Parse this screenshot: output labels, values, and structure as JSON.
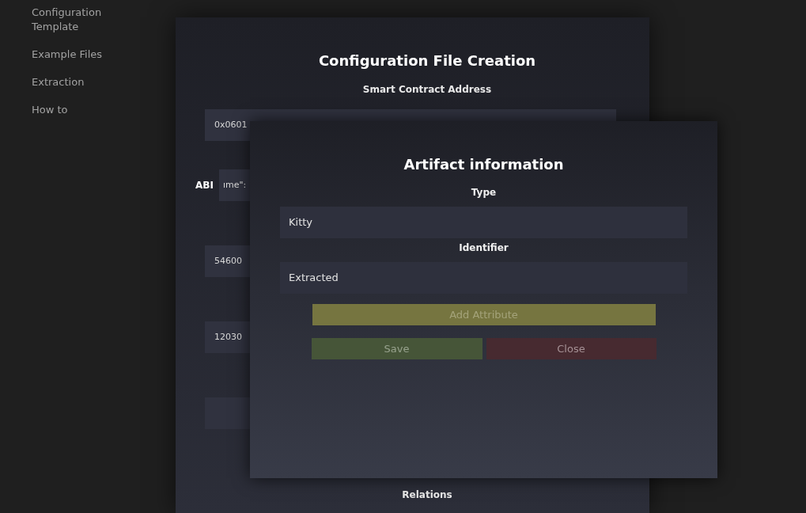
{
  "sidebar": {
    "items": [
      {
        "label": "Configuration Template"
      },
      {
        "label": "Example Files"
      },
      {
        "label": "Extraction"
      },
      {
        "label": "How to"
      }
    ]
  },
  "form": {
    "title": "Configuration File Creation",
    "section_label": "Smart Contract Address",
    "fields": [
      {
        "kind": "text",
        "value": "0x0601"
      },
      {
        "kind": "text",
        "label": "ABI",
        "value": "ıme\":"
      },
      {
        "kind": "text",
        "value": "54600"
      },
      {
        "kind": "text",
        "value": "12030"
      },
      {
        "kind": "blank"
      }
    ],
    "footer_label": "Relations"
  },
  "dialog": {
    "title": "Artifact information",
    "fields": [
      {
        "label": "Type",
        "value": "Kitty"
      },
      {
        "label": "Identifier",
        "value": "Extracted"
      }
    ],
    "buttons": [
      {
        "kind": "add",
        "label": "Add Attribute"
      },
      {
        "kind": "save",
        "label": "Save"
      },
      {
        "kind": "close",
        "label": "Close"
      }
    ]
  }
}
